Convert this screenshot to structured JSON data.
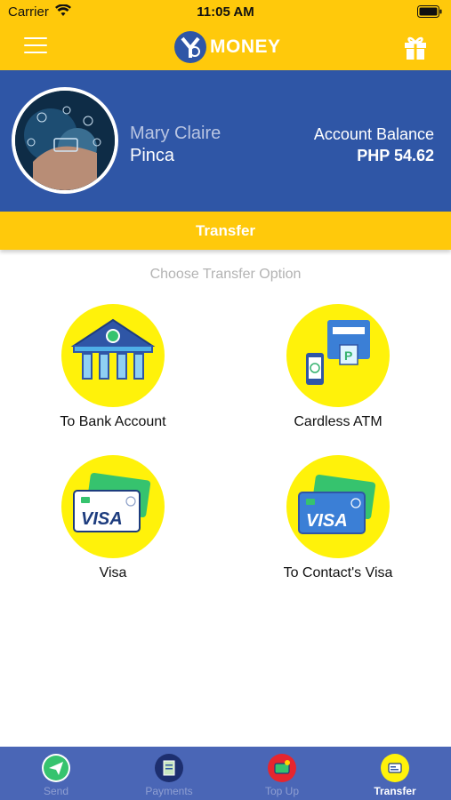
{
  "status_bar": {
    "carrier": "Carrier",
    "time": "11:05 AM",
    "wifi_icon": "wifi-icon",
    "battery_icon": "battery-icon"
  },
  "header": {
    "logo_text": "MONEY",
    "logo_icon": "y-logo-icon",
    "menu_icon": "hamburger-menu-icon",
    "gift_icon": "gift-icon"
  },
  "profile": {
    "first_name": "Mary Claire",
    "last_name": "Pinca",
    "balance_label": "Account Balance",
    "balance_value": "PHP 54.62"
  },
  "section": {
    "title": "Transfer",
    "subtitle": "Choose Transfer Option"
  },
  "options": [
    {
      "label": "To Bank Account",
      "icon": "bank-icon"
    },
    {
      "label": "Cardless ATM",
      "icon": "atm-icon"
    },
    {
      "label": "Visa",
      "icon": "visa-card-icon"
    },
    {
      "label": "To Contact's Visa",
      "icon": "visa-card-blue-icon"
    }
  ],
  "tabbar": {
    "active": "Transfer",
    "tabs": [
      {
        "label": "Send",
        "icon": "send-icon"
      },
      {
        "label": "Payments",
        "icon": "payments-icon"
      },
      {
        "label": "Top Up",
        "icon": "top-up-icon"
      },
      {
        "label": "Transfer",
        "icon": "transfer-icon"
      }
    ]
  },
  "colors": {
    "brand_yellow": "#FFC90B",
    "profile_blue": "#2F56A6",
    "tabbar_blue": "#4A66B6",
    "option_circle": "#FFF20A"
  }
}
